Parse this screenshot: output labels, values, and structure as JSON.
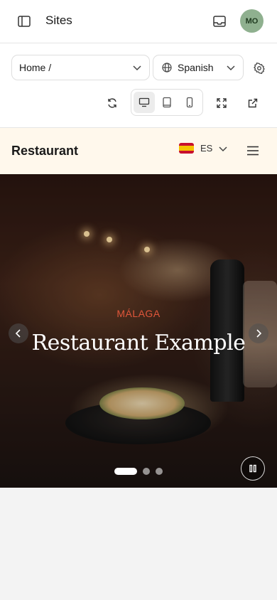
{
  "topbar": {
    "title": "Sites",
    "avatar_initials": "MO"
  },
  "controls": {
    "page_select": "Home /",
    "language_select": "Spanish",
    "device_active": "desktop"
  },
  "site": {
    "brand": "Restaurant",
    "language_code": "ES",
    "hero": {
      "kicker": "MÁLAGA",
      "headline": "Restaurant Example",
      "slides": 3,
      "active_slide": 1
    }
  },
  "colors": {
    "avatar": "#8fb08f",
    "site_header_bg": "#fff8ec",
    "kicker": "#e0563a"
  }
}
